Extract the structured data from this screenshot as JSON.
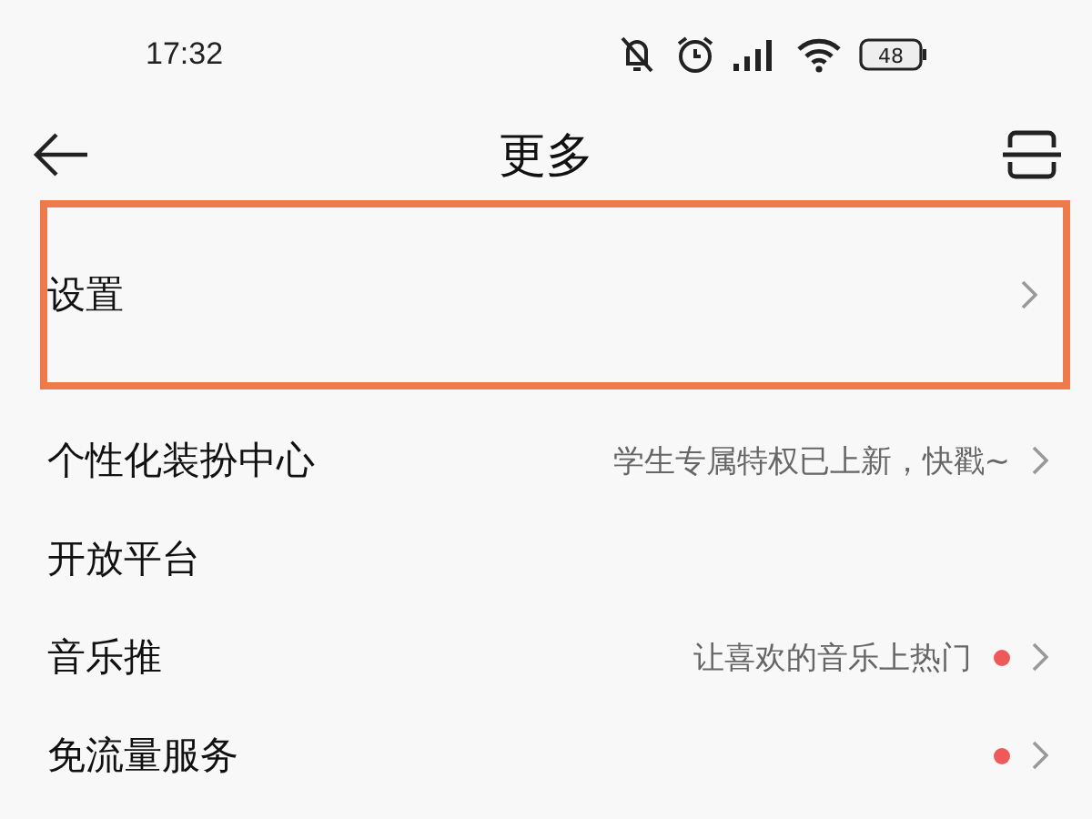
{
  "status_bar": {
    "time": "17:32",
    "battery": "48"
  },
  "header": {
    "title": "更多"
  },
  "items": [
    {
      "label": "设置",
      "dot": false,
      "chevron": true,
      "outlined": true
    },
    {
      "label": "个性化装扮中心",
      "hint": "学生专属特权已上新，快戳~",
      "dot": false,
      "chevron": true,
      "outlined": false
    },
    {
      "label": "开放平台",
      "dot": false,
      "chevron": false,
      "outlined": false
    },
    {
      "label": "音乐推",
      "hint": "让喜欢的音乐上热门",
      "dot": true,
      "chevron": true,
      "outlined": false
    },
    {
      "label": "免流量服务",
      "dot": true,
      "chevron": true,
      "outlined": false
    }
  ]
}
